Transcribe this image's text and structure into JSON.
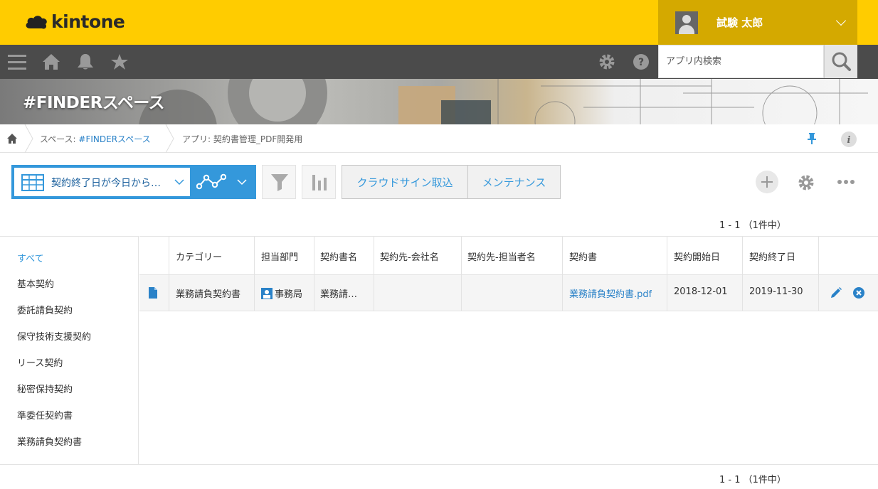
{
  "brand": {
    "logo_text": "kintone",
    "accent": "#ffcc00"
  },
  "user": {
    "name": "試験 太郎"
  },
  "nav": {
    "icons": [
      "menu-icon",
      "home-icon",
      "bell-icon",
      "star-icon"
    ],
    "right_icons": [
      "gear-icon",
      "help-icon"
    ],
    "search_placeholder": "アプリ内検索"
  },
  "space": {
    "title": "#FINDERスペース"
  },
  "breadcrumb": {
    "space_prefix": "スペース: ",
    "space_name": "#FINDERスペース",
    "app_label": "アプリ: 契約書管理_PDF開発用"
  },
  "toolbar": {
    "view_name": "契約終了日が今日から…",
    "custom_buttons": [
      "クラウドサイン取込",
      "メンテナンス"
    ],
    "pager_text": "1 - 1 （1件中）"
  },
  "sidebar": {
    "items": [
      {
        "label": "すべて",
        "active": true
      },
      {
        "label": "基本契約",
        "active": false
      },
      {
        "label": "委託請負契約",
        "active": false
      },
      {
        "label": "保守技術支援契約",
        "active": false
      },
      {
        "label": "リース契約",
        "active": false
      },
      {
        "label": "秘密保持契約",
        "active": false
      },
      {
        "label": "準委任契約書",
        "active": false
      },
      {
        "label": "業務請負契約書",
        "active": false
      }
    ]
  },
  "table": {
    "headers": [
      "カテゴリー",
      "担当部門",
      "契約書名",
      "契約先-会社名",
      "契約先-担当者名",
      "契約書",
      "契約開始日",
      "契約終了日"
    ],
    "rows": [
      {
        "category": "業務請負契約書",
        "department": "事務局",
        "contract_name": "業務請…",
        "company": "",
        "contact": "",
        "file": "業務請負契約書.pdf",
        "start_date": "2018-12-01",
        "end_date": "2019-11-30"
      }
    ]
  },
  "footer": {
    "pager_text": "1 - 1 （1件中）"
  }
}
